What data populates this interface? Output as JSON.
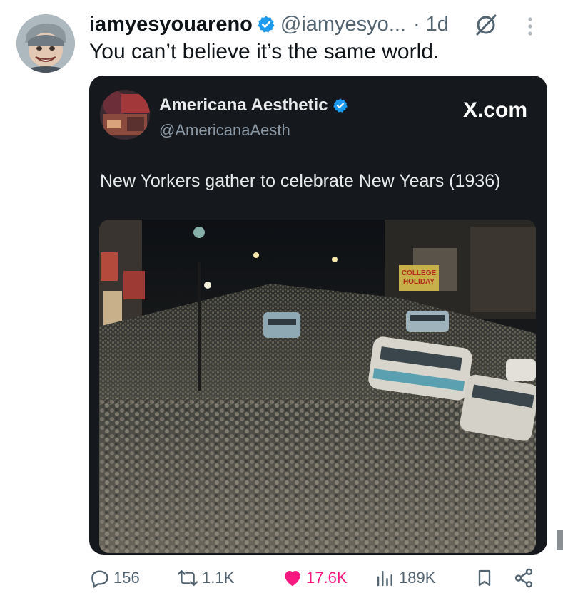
{
  "tweet": {
    "author": {
      "display_name": "iamyesyouareno",
      "handle": "@iamyesyo...",
      "verified": true,
      "avatar_icon": "avatar-caricature-icon"
    },
    "separator": "·",
    "time_ago": "1d",
    "grok_icon": "grok-icon",
    "more_icon": "more-vertical-icon",
    "text": "You can’t believe it’s the same world."
  },
  "quoted_post": {
    "author": {
      "display_name": "Americana Aesthetic",
      "handle": "@AmericanaAesth",
      "verified": true,
      "avatar_icon": "avatar-photo-icon"
    },
    "source_label": "X.com",
    "text": "New Yorkers gather to celebrate New Years (1936)",
    "image": {
      "alt_icon": "crowd-photo-icon",
      "sign_text": "COLLEGE HOLIDAY"
    }
  },
  "actions": {
    "reply": {
      "icon": "reply-icon",
      "count": "156"
    },
    "repost": {
      "icon": "repost-icon",
      "count": "1.1K"
    },
    "like": {
      "icon": "heart-icon",
      "count": "17.6K",
      "liked": true
    },
    "views": {
      "icon": "views-icon",
      "count": "189K"
    },
    "bookmark": {
      "icon": "bookmark-icon"
    },
    "share": {
      "icon": "share-icon"
    }
  },
  "colors": {
    "text_primary": "#0f1419",
    "text_secondary": "#536471",
    "verified_blue": "#1d9bf0",
    "like_pink": "#f91880",
    "card_background": "#15181c"
  }
}
